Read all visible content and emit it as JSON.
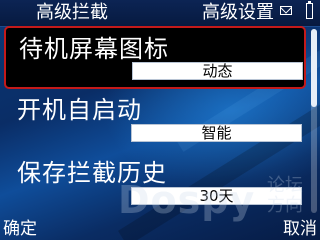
{
  "status_bar": {
    "title_left": "高级拦截",
    "title_right": "高级设置",
    "icons": [
      "mail-icon",
      "battery-icon"
    ]
  },
  "settings": {
    "items": [
      {
        "label": "待机屏幕图标",
        "value": "动态",
        "selected": true
      },
      {
        "label": "开机自启动",
        "value": "智能",
        "selected": false
      },
      {
        "label": "保存拦截历史",
        "value": "30天",
        "selected": false
      }
    ]
  },
  "watermark": {
    "text": "Dospy",
    "text_cn": "论坛方向"
  },
  "softkeys": {
    "left": "确定",
    "right": "取消"
  },
  "colors": {
    "selection_border": "#c41a1a",
    "background": "#0b2a5c"
  }
}
